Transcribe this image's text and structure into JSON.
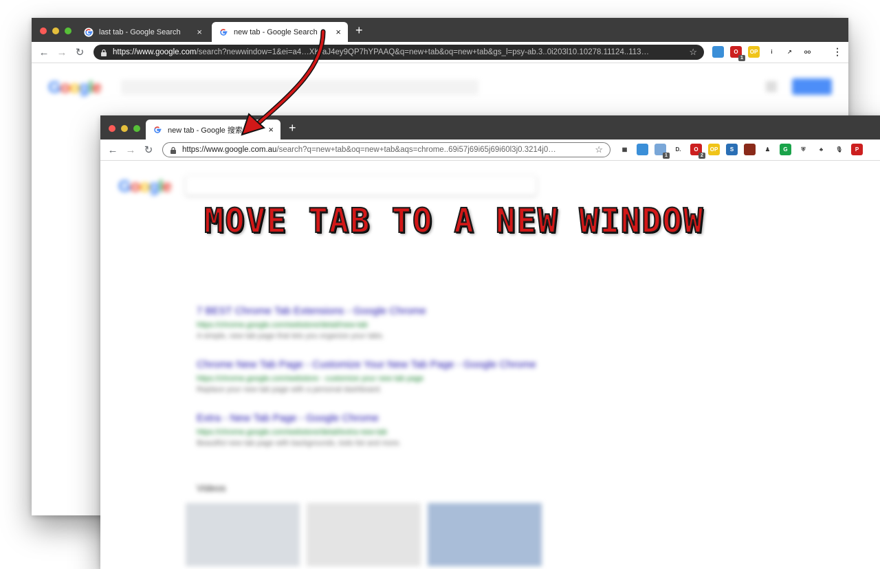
{
  "colors": {
    "tabstrip_bg": "#3c3c3c",
    "traffic_red": "#fc5b57",
    "traffic_yellow": "#e5bf3c",
    "traffic_green": "#57c038",
    "headline_red": "#d21818",
    "arrow_red": "#d21818"
  },
  "back_window": {
    "tabs": [
      {
        "title": "last tab - Google Search",
        "active": false
      },
      {
        "title": "new tab - Google Search",
        "active": true
      }
    ],
    "new_tab_label": "+",
    "close_label": "×",
    "nav": {
      "back": "←",
      "forward": "→",
      "reload": "↻"
    },
    "url_host": "https://www.google.com",
    "url_rest": "/search?newwindow=1&ei=a4…XK-aJ4ey9QP7hYPAAQ&q=new+tab&oq=new+tab&gs_l=psy-ab.3..0i203l10.10278.11124..113…",
    "bookmark_icon": "☆",
    "extensions": [
      {
        "name": "blue-bird-extension-icon",
        "color": "#3b8fd8",
        "text": ""
      },
      {
        "name": "red-o-extension-icon",
        "color": "#cc1f1f",
        "text": "O",
        "badge": "1"
      },
      {
        "name": "op-extension-icon",
        "color": "#f0c419",
        "text": "OP"
      },
      {
        "name": "info-extension-icon",
        "color": "#ffffff",
        "text": "i"
      },
      {
        "name": "rss-extension-icon",
        "color": "#ffffff",
        "text": "↗"
      },
      {
        "name": "glasses-extension-icon",
        "color": "#ffffff",
        "text": "oo"
      }
    ],
    "menu_label": "⋮"
  },
  "front_window": {
    "tabs": [
      {
        "title": "new tab - Google 搜索",
        "active": true
      }
    ],
    "new_tab_label": "+",
    "close_label": "×",
    "nav": {
      "back": "←",
      "forward": "→",
      "reload": "↻"
    },
    "url_host": "https://www.google.com.au",
    "url_rest": "/search?q=new+tab&oq=new+tab&aqs=chrome..69i57j69i65j69i60l3j0.3214j0…",
    "bookmark_icon": "☆",
    "extensions": [
      {
        "name": "qr-extension-icon",
        "color": "#ffffff",
        "text": "▦"
      },
      {
        "name": "blue-bird-extension-icon",
        "color": "#3b8fd8",
        "text": ""
      },
      {
        "name": "translate-extension-icon",
        "color": "#7aa7d8",
        "text": "",
        "badge": "1"
      },
      {
        "name": "d-extension-icon",
        "color": "#ffffff",
        "text": "D."
      },
      {
        "name": "red-o-extension-icon",
        "color": "#cc1f1f",
        "text": "O",
        "badge": "2"
      },
      {
        "name": "op-extension-icon",
        "color": "#f0c419",
        "text": "OP"
      },
      {
        "name": "screen-extension-icon",
        "color": "#2a6fb5",
        "text": "S"
      },
      {
        "name": "brave-lion-extension-icon",
        "color": "#8a2a1a",
        "text": ""
      },
      {
        "name": "spy-extension-icon",
        "color": "#ffffff",
        "text": "♟"
      },
      {
        "name": "grammarly-extension-icon",
        "color": "#1aa34a",
        "text": "G"
      },
      {
        "name": "shield-extension-icon",
        "color": "#ffffff",
        "text": "⛨"
      },
      {
        "name": "android-extension-icon",
        "color": "#ffffff",
        "text": "♣"
      },
      {
        "name": "microphone-extension-icon",
        "color": "#ffffff",
        "text": "🎙"
      },
      {
        "name": "pinterest-extension-icon",
        "color": "#cc1f1f",
        "text": "P"
      }
    ]
  },
  "blurred_results": [
    {
      "title": "7 BEST Chrome Tab Extensions - Google Chrome",
      "url": "https://chrome.google.com/webstore/detail/new-tab",
      "snippet": "A simple, new tab page that lets you organize your tabs."
    },
    {
      "title": "Chrome New Tab Page - Customize Your New Tab Page - Google Chrome",
      "url": "https://chrome.google.com/webstore - customize your new tab page",
      "snippet": "Replace your new tab page with a personal dashboard."
    },
    {
      "title": "Extra - New Tab Page - Google Chrome",
      "url": "https://chrome.google.com/webstore/detail/extra-new-tab",
      "snippet": "Beautiful new tab page with backgrounds, todo list and more."
    }
  ],
  "blurred_section_label": "Videos",
  "headline": "MOVE TAB TO A NEW WINDOW"
}
